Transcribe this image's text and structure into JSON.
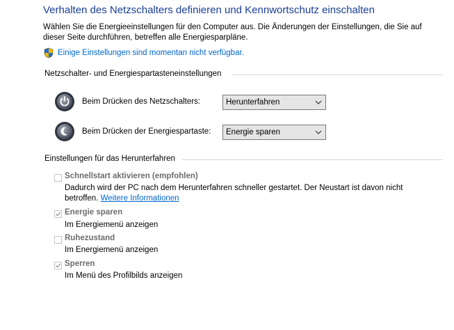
{
  "header": {
    "title": "Verhalten des Netzschalters definieren und Kennwortschutz einschalten",
    "description": "Wählen Sie die Energieeinstellungen für den Computer aus. Die Änderungen der Einstellungen, die Sie auf dieser Seite durchführen, betreffen alle Energiesparpläne.",
    "unavailable_link": "Einige Einstellungen sind momentan nicht verfügbar."
  },
  "buttons_section": {
    "heading": "Netzschalter- und Energiespartasteneinstellungen",
    "power_button": {
      "label": "Beim Drücken des Netzschalters:",
      "selected": "Herunterfahren",
      "icon": "power-button-icon"
    },
    "sleep_button": {
      "label": "Beim Drücken der Energiespartaste:",
      "selected": "Energie sparen",
      "icon": "sleep-button-icon"
    }
  },
  "shutdown_section": {
    "heading": "Einstellungen für das Herunterfahren",
    "options": [
      {
        "label": "Schnellstart aktivieren (empfohlen)",
        "checked": false,
        "description": "Dadurch wird der PC nach dem Herunterfahren schneller gestartet. Der Neustart ist davon nicht betroffen.",
        "link": "Weitere Informationen"
      },
      {
        "label": "Energie sparen",
        "checked": true,
        "description": "Im Energiemenü anzeigen"
      },
      {
        "label": "Ruhezustand",
        "checked": false,
        "description": "Im Energiemenü anzeigen"
      },
      {
        "label": "Sperren",
        "checked": true,
        "description": "Im Menü des Profilbilds anzeigen"
      }
    ]
  },
  "colors": {
    "title": "#1a3e96",
    "link": "#0066cc",
    "disabled_text": "#6d6d6d",
    "dropdown_bg": "#e5e5e5"
  }
}
